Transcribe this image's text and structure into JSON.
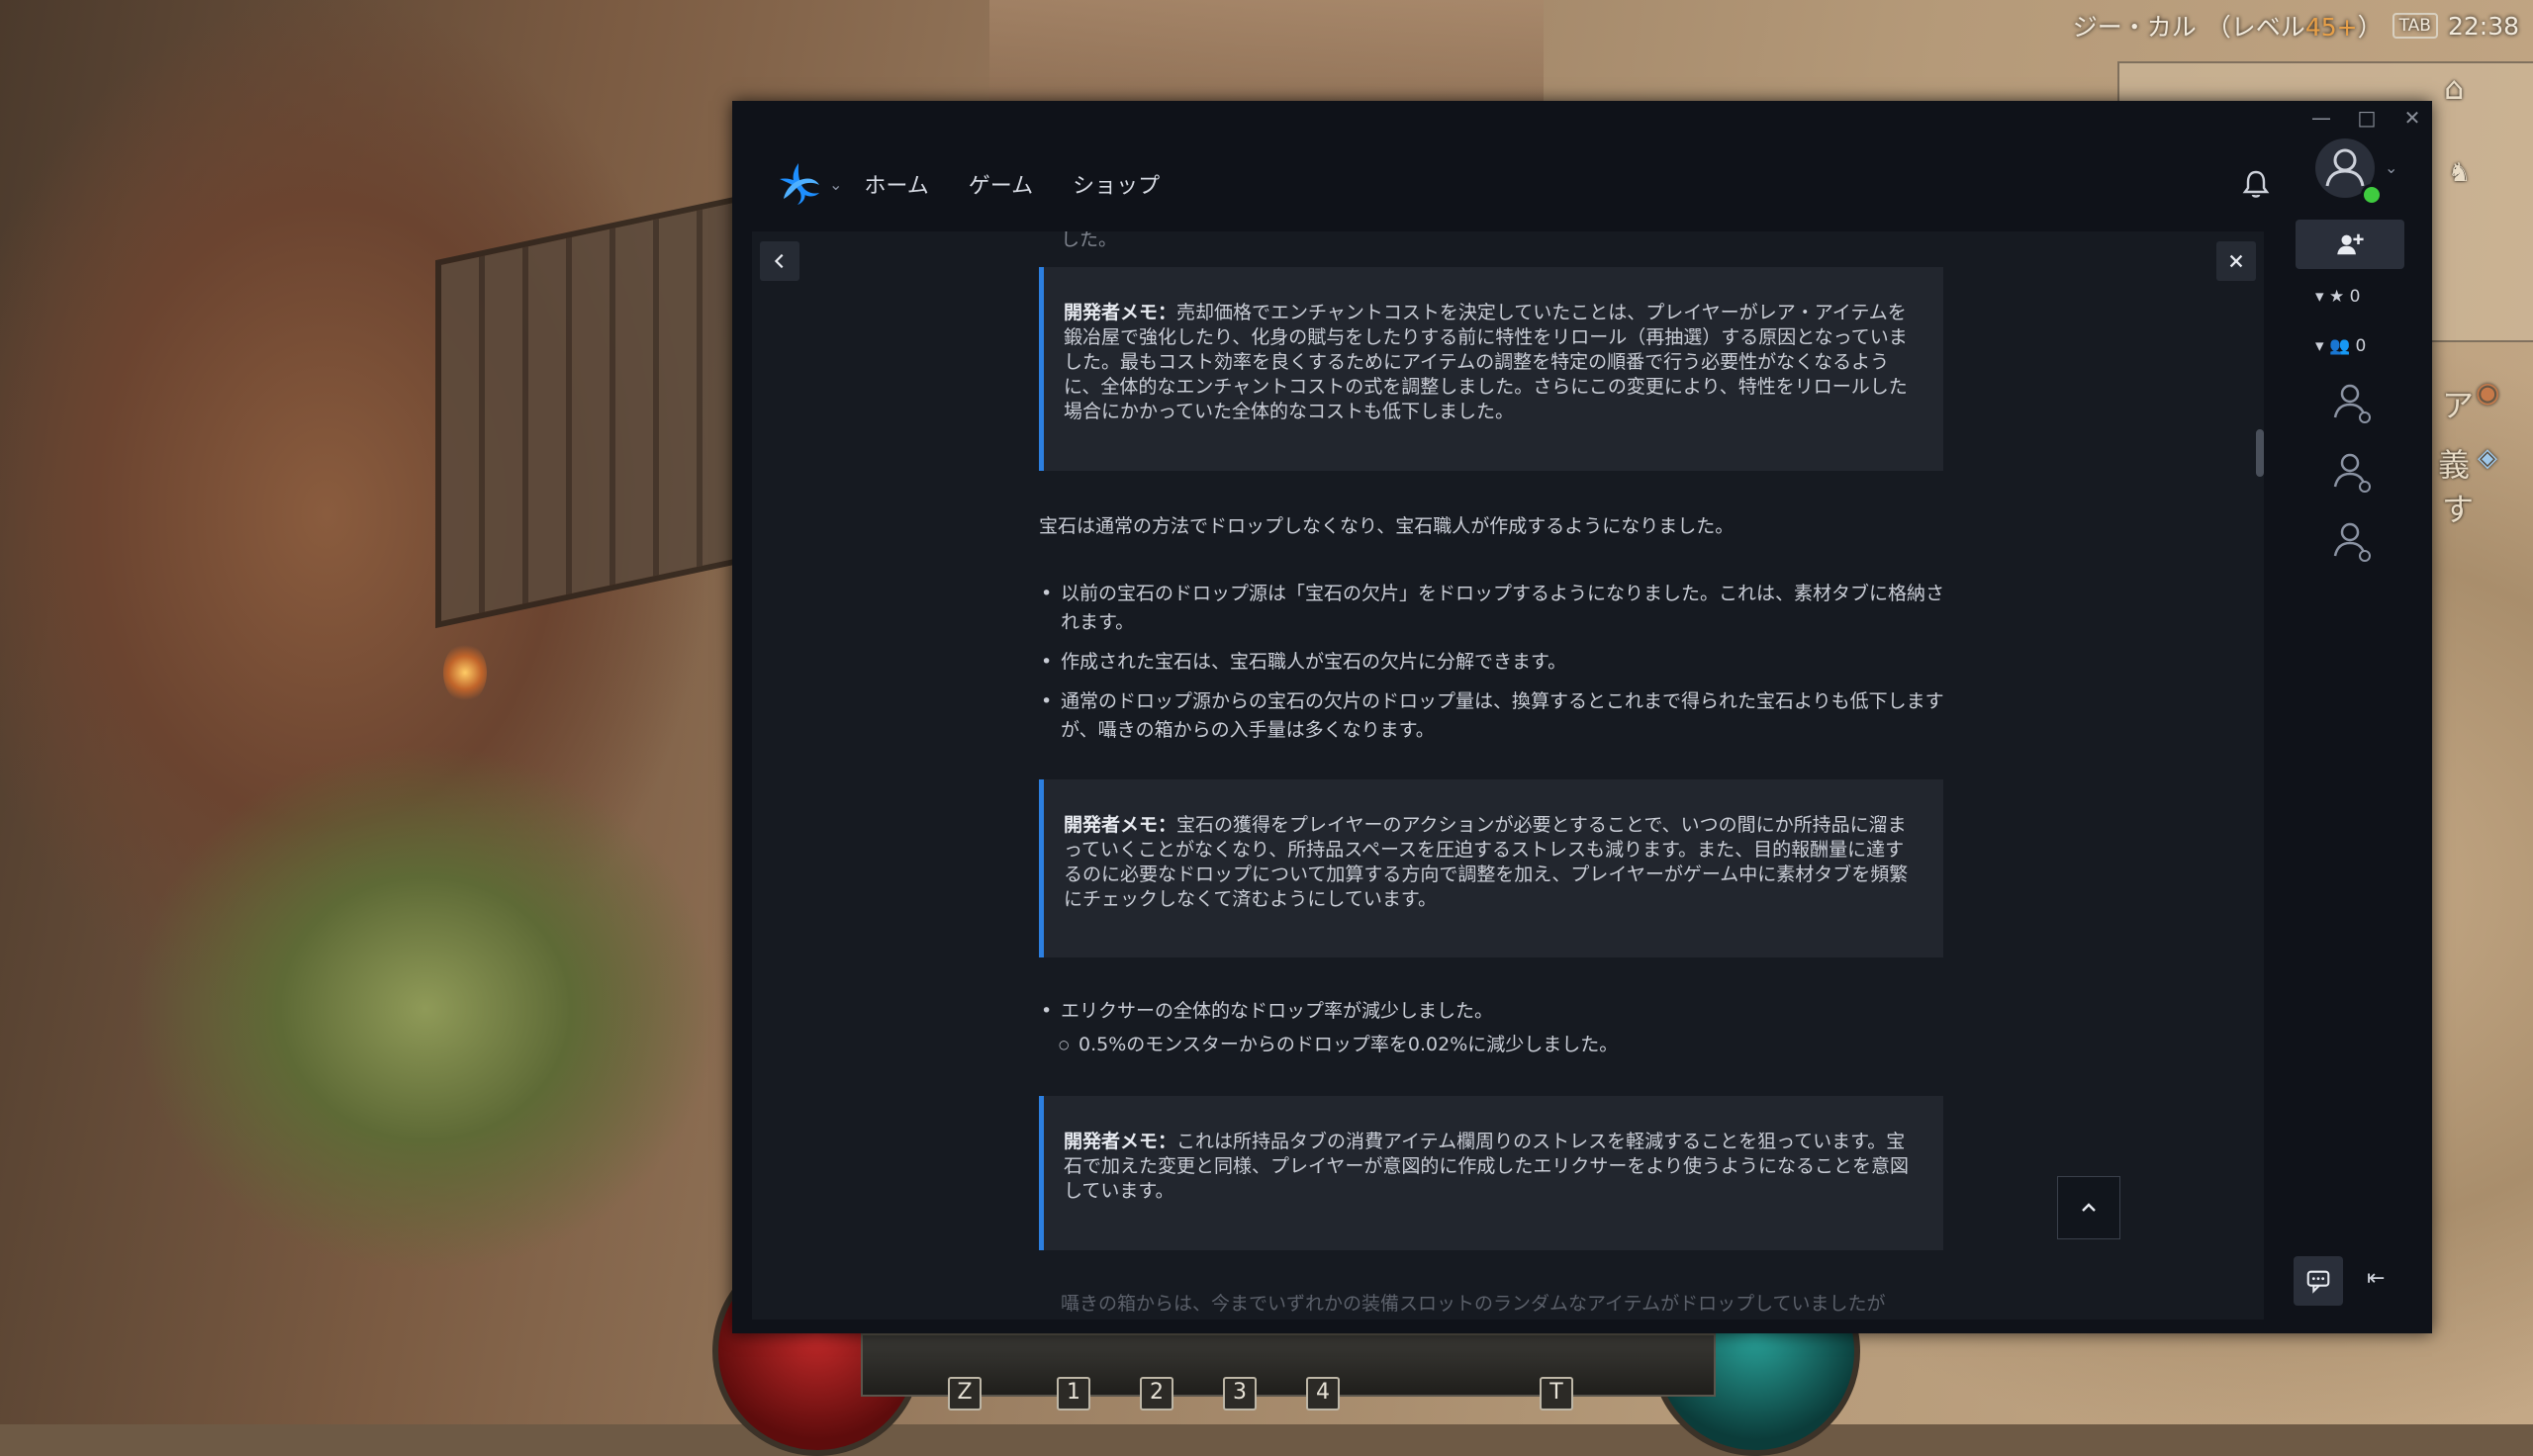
{
  "game_hud": {
    "character_name": "ジー・カル",
    "level_prefix": "（レベル",
    "level_value": "45+",
    "level_suffix": "）",
    "tab_key": "TAB",
    "clock": "22:38",
    "side_text_1": "ア",
    "side_text_2": "義",
    "side_text_3": "す",
    "hotkeys": [
      "Z",
      "1",
      "2",
      "3",
      "4",
      "T"
    ]
  },
  "window_controls": {
    "minimize": "—",
    "maximize": "□",
    "close": "✕"
  },
  "nav": {
    "links": [
      "ホーム",
      "ゲーム",
      "ショップ"
    ],
    "caret": "⌄"
  },
  "social": {
    "favorites_count": "0",
    "friends_count": "0"
  },
  "article": {
    "cut_text": "した。",
    "note1_label": "開発者メモ：",
    "note1_text": "売却価格でエンチャントコストを決定していたことは、プレイヤーがレア・アイテムを鍛冶屋で強化したり、化身の賦与をしたりする前に特性をリロール（再抽選）する原因となっていました。最もコスト効率を良くするためにアイテムの調整を特定の順番で行う必要性がなくなるように、全体的なエンチャントコストの式を調整しました。さらにこの変更により、特性をリロールした場合にかかっていた全体的なコストも低下しました。",
    "para1": "宝石は通常の方法でドロップしなくなり、宝石職人が作成するようになりました。",
    "bullets1": [
      "以前の宝石のドロップ源は「宝石の欠片」をドロップするようになりました。これは、素材タブに格納されます。",
      "作成された宝石は、宝石職人が宝石の欠片に分解できます。",
      "通常のドロップ源からの宝石の欠片のドロップ量は、換算するとこれまで得られた宝石よりも低下しますが、囁きの箱からの入手量は多くなります。"
    ],
    "note2_label": "開発者メモ：",
    "note2_text": "宝石の獲得をプレイヤーのアクションが必要とすることで、いつの間にか所持品に溜まっていくことがなくなり、所持品スペースを圧迫するストレスも減ります。また、目的報酬量に達するのに必要なドロップについて加算する方向で調整を加え、プレイヤーがゲーム中に素材タブを頻繁にチェックしなくて済むようにしています。",
    "bullet2": "エリクサーの全体的なドロップ率が減少しました。",
    "sub_bullet2": "0.5%のモンスターからのドロップ率を0.02%に減少しました。",
    "note3_label": "開発者メモ：",
    "note3_text": "これは所持品タブの消費アイテム欄周りのストレスを軽減することを狙っています。宝石で加えた変更と同様、プレイヤーが意図的に作成したエリクサーをより使うようになることを意図しています。",
    "fade_text": "囁きの箱からは、今までいずれかの装備スロットのランダムなアイテムがドロップしていましたが"
  },
  "colors": {
    "accent": "#2c7fe0",
    "window_bg": "#0f1219",
    "modal_bg": "#161a21",
    "note_bg": "#22262e",
    "presence": "#3fcb3f"
  }
}
